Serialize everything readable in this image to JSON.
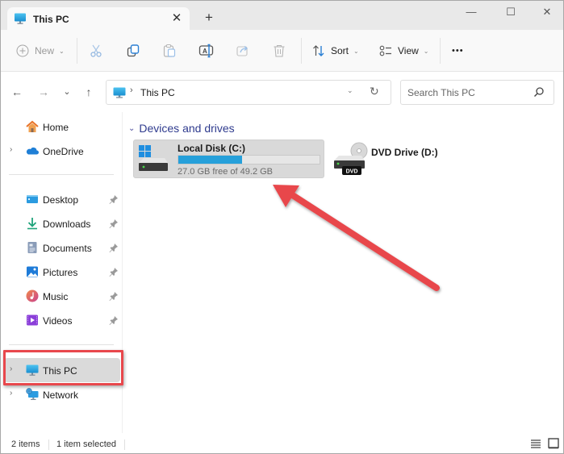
{
  "window": {
    "tab_title": "This PC",
    "tab_close": "✕",
    "new_tab": "+",
    "controls": {
      "minimize": "—",
      "maximize": "☐",
      "close": "✕"
    }
  },
  "toolbar": {
    "new_label": "New",
    "sort_label": "Sort",
    "view_label": "View",
    "more_label": "•••",
    "buttons": [
      {
        "id": "cut",
        "icon": "scissors-icon",
        "enabled": false
      },
      {
        "id": "copy",
        "icon": "copy-icon",
        "enabled": true
      },
      {
        "id": "paste",
        "icon": "clipboard-icon",
        "enabled": false
      },
      {
        "id": "rename",
        "icon": "rename-icon",
        "enabled": true
      },
      {
        "id": "share",
        "icon": "share-icon",
        "enabled": false
      },
      {
        "id": "delete",
        "icon": "trash-icon",
        "enabled": false
      }
    ]
  },
  "nav": {
    "back": "←",
    "forward": "→",
    "recent": "⌄",
    "up": "↑",
    "breadcrumb_sep": "›",
    "address": "This PC",
    "dropdown": "⌄",
    "refresh": "↻",
    "search_placeholder": "Search This PC"
  },
  "sidebar": {
    "items": [
      {
        "label": "Home",
        "icon": "home-icon",
        "expandable": false,
        "pinned": false
      },
      {
        "label": "OneDrive",
        "icon": "onedrive-cloud-icon",
        "expandable": true,
        "pinned": false
      },
      {
        "label": "Desktop",
        "icon": "desktop-folder-icon",
        "expandable": false,
        "pinned": true
      },
      {
        "label": "Downloads",
        "icon": "downloads-icon",
        "expandable": false,
        "pinned": true
      },
      {
        "label": "Documents",
        "icon": "documents-icon",
        "expandable": false,
        "pinned": true
      },
      {
        "label": "Pictures",
        "icon": "pictures-icon",
        "expandable": false,
        "pinned": true
      },
      {
        "label": "Music",
        "icon": "music-icon",
        "expandable": false,
        "pinned": true
      },
      {
        "label": "Videos",
        "icon": "videos-icon",
        "expandable": false,
        "pinned": true
      },
      {
        "label": "This PC",
        "icon": "monitor-icon",
        "expandable": true,
        "pinned": false,
        "selected": true
      },
      {
        "label": "Network",
        "icon": "network-icon",
        "expandable": true,
        "pinned": false
      }
    ]
  },
  "content": {
    "group_title": "Devices and drives",
    "drives": [
      {
        "name": "Local Disk (C:)",
        "free_text": "27.0 GB free of 49.2 GB",
        "free_gb": 27.0,
        "total_gb": 49.2,
        "used_fraction": 0.451,
        "selected": true
      },
      {
        "name": "DVD Drive (D:)",
        "badge": "DVD",
        "selected": false
      }
    ]
  },
  "status": {
    "item_count": "2 items",
    "selection": "1 item selected"
  },
  "annotation": {
    "color": "#e8474c",
    "target": "This PC"
  },
  "colors": {
    "accent_bar": "#26a0da",
    "group_title": "#2f3b8e",
    "highlight": "#e8474c"
  }
}
